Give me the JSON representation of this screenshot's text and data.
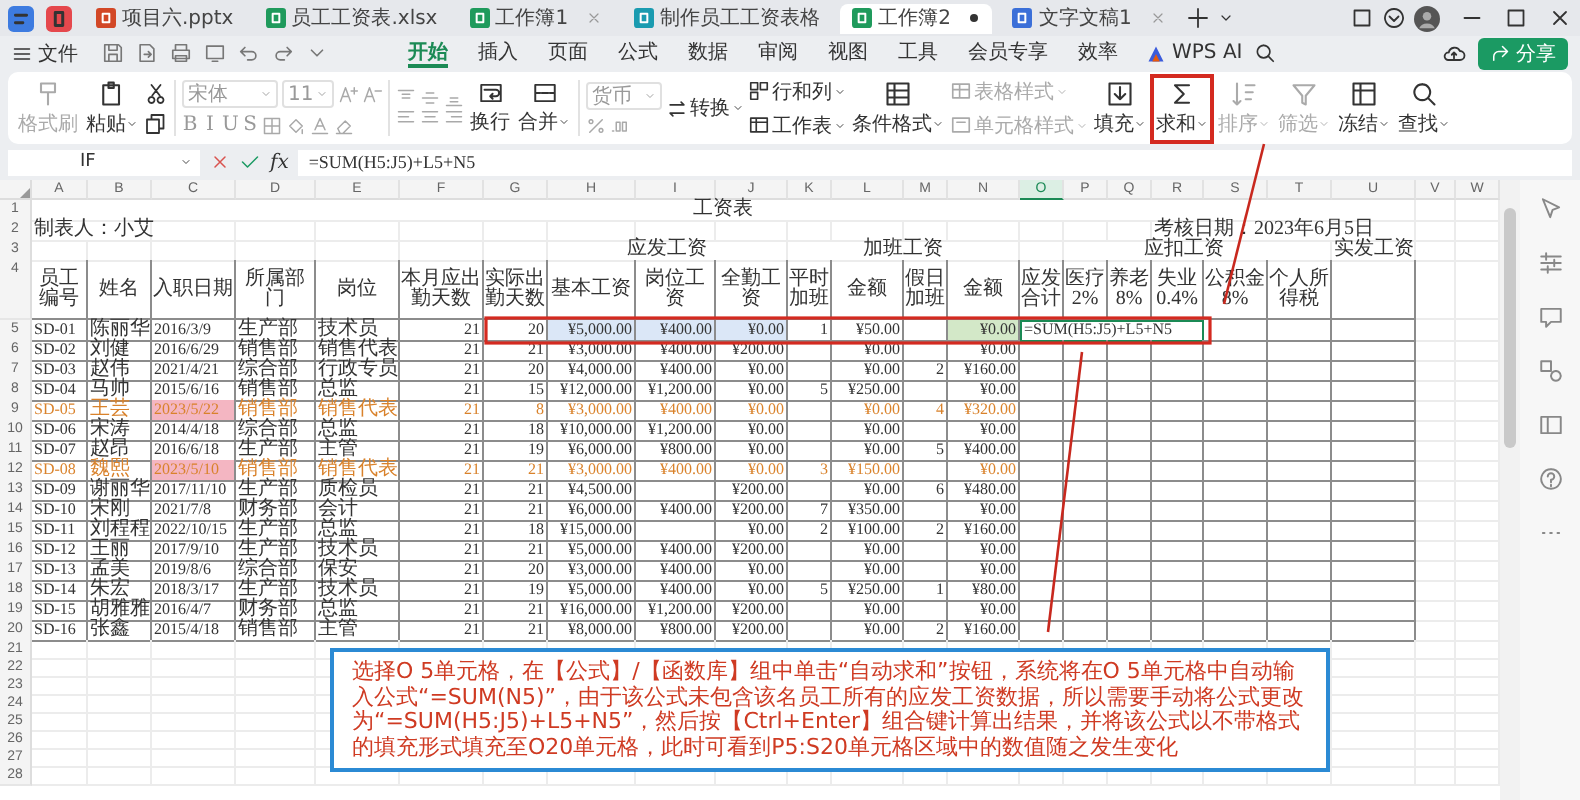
{
  "app_tabs": [
    {
      "label": "项目六.pptx",
      "kind": "presentation",
      "selected": false,
      "close_button": false,
      "unsaved": false
    },
    {
      "label": "员工工资表.xlsx",
      "kind": "spreadsheet",
      "selected": false,
      "close_button": false,
      "unsaved": false
    },
    {
      "label": "工作簿1",
      "kind": "spreadsheet",
      "selected": false,
      "close_button": true,
      "unsaved": false
    },
    {
      "label": "制作员工工资表格",
      "kind": "flowchart",
      "selected": false,
      "close_button": false,
      "unsaved": false
    },
    {
      "label": "工作簿2",
      "kind": "spreadsheet",
      "selected": true,
      "close_button": false,
      "unsaved": true
    },
    {
      "label": "文字文稿1",
      "kind": "document",
      "selected": false,
      "close_button": true,
      "unsaved": false
    }
  ],
  "menu": {
    "file": "文件",
    "tabs": [
      {
        "label": "开始",
        "selected": true
      },
      {
        "label": "插入",
        "selected": false
      },
      {
        "label": "页面",
        "selected": false
      },
      {
        "label": "公式",
        "selected": false
      },
      {
        "label": "数据",
        "selected": false
      },
      {
        "label": "审阅",
        "selected": false
      },
      {
        "label": "视图",
        "selected": false
      },
      {
        "label": "工具",
        "selected": false
      },
      {
        "label": "会员专享",
        "selected": false
      },
      {
        "label": "效率",
        "selected": false
      }
    ],
    "ai": "WPS AI",
    "share": "分享"
  },
  "ribbon": {
    "clipboard": [
      {
        "label": "格式刷",
        "disabled": true
      },
      {
        "label": "粘贴",
        "disabled": false
      }
    ],
    "font": {
      "name": "宋体",
      "size": "11",
      "styles": [
        "B",
        "I",
        "U",
        "S"
      ]
    },
    "wrap": "换行",
    "merge": "合并",
    "number_format": "货币",
    "tool_columns": [
      {
        "kind": "stack",
        "tools": [
          {
            "label": "转换",
            "disabled": false
          }
        ]
      },
      {
        "kind": "stack",
        "tools": [
          {
            "label": "行和列",
            "disabled": false
          },
          {
            "label": "工作表",
            "disabled": false
          }
        ]
      },
      {
        "kind": "large",
        "label": "条件格式",
        "disabled": false,
        "highlighted": false
      },
      {
        "kind": "stack",
        "tools": [
          {
            "label": "表格样式",
            "disabled": true
          },
          {
            "label": "单元格样式",
            "disabled": true
          }
        ]
      },
      {
        "kind": "large",
        "label": "填充",
        "disabled": false,
        "highlighted": false
      },
      {
        "kind": "large",
        "label": "求和",
        "disabled": false,
        "highlighted": true
      },
      {
        "kind": "large",
        "label": "排序",
        "disabled": true,
        "highlighted": false
      },
      {
        "kind": "large",
        "label": "筛选",
        "disabled": true,
        "highlighted": false
      },
      {
        "kind": "large",
        "label": "冻结",
        "disabled": false,
        "highlighted": false
      },
      {
        "kind": "large",
        "label": "查找",
        "disabled": false,
        "highlighted": false
      }
    ]
  },
  "formula_bar": {
    "name_box": "IF",
    "function_label": "fx",
    "formula": "=SUM(H5:J5)+L5+N5"
  },
  "sheet": {
    "columns": [
      {
        "letter": "A",
        "selected": false
      },
      {
        "letter": "B",
        "selected": false
      },
      {
        "letter": "C",
        "selected": false
      },
      {
        "letter": "D",
        "selected": false
      },
      {
        "letter": "E",
        "selected": false
      },
      {
        "letter": "F",
        "selected": false
      },
      {
        "letter": "G",
        "selected": false
      },
      {
        "letter": "H",
        "selected": false
      },
      {
        "letter": "I",
        "selected": false
      },
      {
        "letter": "J",
        "selected": false
      },
      {
        "letter": "K",
        "selected": false
      },
      {
        "letter": "L",
        "selected": false
      },
      {
        "letter": "M",
        "selected": false
      },
      {
        "letter": "N",
        "selected": false
      },
      {
        "letter": "O",
        "selected": true
      },
      {
        "letter": "P",
        "selected": false
      },
      {
        "letter": "Q",
        "selected": false
      },
      {
        "letter": "R",
        "selected": false
      },
      {
        "letter": "S",
        "selected": false
      },
      {
        "letter": "T",
        "selected": false
      },
      {
        "letter": "U",
        "selected": false
      },
      {
        "letter": "V",
        "selected": false
      },
      {
        "letter": "W",
        "selected": false
      }
    ],
    "row_numbers": [
      "1",
      "2",
      "3",
      "4",
      "5",
      "6",
      "7",
      "8",
      "9",
      "10",
      "11",
      "12",
      "13",
      "14",
      "15",
      "16",
      "17",
      "18",
      "19",
      "20",
      "21",
      "22",
      "23",
      "24",
      "25",
      "26",
      "27",
      "28"
    ],
    "title": "工资表",
    "maker": "制表人：小艾",
    "check_date": "考核日期：2023年6月5日",
    "group_headers": {
      "payable": "应发工资",
      "overtime": "加班工资",
      "deductions": "应扣工资",
      "net_pay": "实发工资"
    },
    "headers": [
      "员工编号",
      "姓名",
      "入职日期",
      "所属部门",
      "岗位",
      "本月应出勤天数",
      "实际出勤天数",
      "基本工资",
      "岗位工资",
      "全勤工资",
      "平时加班",
      "金额",
      "假日加班",
      "金额",
      "应发合计",
      "医疗2%",
      "养老8%",
      "失业0.4%",
      "公积金8%",
      "个人所得税"
    ],
    "records": [
      {
        "id": "SD-01",
        "name": "陈丽华",
        "hired": "2016/3/9",
        "dept": "生产部",
        "post": "技术员",
        "due": "21",
        "actual": "20",
        "base": "¥5,000.00",
        "post_pay": "¥400.00",
        "attend": "¥0.00",
        "ot": "1",
        "ot_pay": "¥50.00",
        "hol_pay": "¥0.00",
        "flagged": false,
        "in_formula": true,
        "formula": "=SUM(H5:J5)+L5+N5"
      },
      {
        "id": "SD-02",
        "name": "刘健",
        "hired": "2016/6/29",
        "dept": "销售部",
        "post": "销售代表",
        "due": "21",
        "actual": "21",
        "base": "¥3,000.00",
        "post_pay": "¥400.00",
        "attend": "¥200.00",
        "ot_pay": "¥0.00",
        "hol_pay": "¥0.00",
        "flagged": false,
        "in_formula": false
      },
      {
        "id": "SD-03",
        "name": "赵伟",
        "hired": "2021/4/21",
        "dept": "综合部",
        "post": "行政专员",
        "due": "21",
        "actual": "20",
        "base": "¥4,000.00",
        "post_pay": "¥400.00",
        "attend": "¥0.00",
        "ot_pay": "¥0.00",
        "hol": "2",
        "hol_pay": "¥160.00",
        "flagged": false,
        "in_formula": false
      },
      {
        "id": "SD-04",
        "name": "马帅",
        "hired": "2015/6/16",
        "dept": "销售部",
        "post": "总监",
        "due": "21",
        "actual": "15",
        "base": "¥12,000.00",
        "post_pay": "¥1,200.00",
        "attend": "¥0.00",
        "ot": "5",
        "ot_pay": "¥250.00",
        "hol_pay": "¥0.00",
        "flagged": false,
        "in_formula": false
      },
      {
        "id": "SD-05",
        "name": "王芸",
        "hired": "2023/5/22",
        "dept": "销售部",
        "post": "销售代表",
        "due": "21",
        "actual": "8",
        "base": "¥3,000.00",
        "post_pay": "¥400.00",
        "attend": "¥0.00",
        "ot_pay": "¥0.00",
        "hol": "4",
        "hol_pay": "¥320.00",
        "flagged": true,
        "in_formula": false
      },
      {
        "id": "SD-06",
        "name": "宋涛",
        "hired": "2014/4/18",
        "dept": "综合部",
        "post": "总监",
        "due": "21",
        "actual": "18",
        "base": "¥10,000.00",
        "post_pay": "¥1,200.00",
        "attend": "¥0.00",
        "ot_pay": "¥0.00",
        "hol_pay": "¥0.00",
        "flagged": false,
        "in_formula": false
      },
      {
        "id": "SD-07",
        "name": "赵昂",
        "hired": "2016/6/18",
        "dept": "生产部",
        "post": "主管",
        "due": "21",
        "actual": "19",
        "base": "¥6,000.00",
        "post_pay": "¥800.00",
        "attend": "¥0.00",
        "ot_pay": "¥0.00",
        "hol": "5",
        "hol_pay": "¥400.00",
        "flagged": false,
        "in_formula": false
      },
      {
        "id": "SD-08",
        "name": "魏熙",
        "hired": "2023/5/10",
        "dept": "销售部",
        "post": "销售代表",
        "due": "21",
        "actual": "21",
        "base": "¥3,000.00",
        "post_pay": "¥400.00",
        "attend": "¥0.00",
        "ot": "3",
        "ot_pay": "¥150.00",
        "hol_pay": "¥0.00",
        "flagged": true,
        "in_formula": false
      },
      {
        "id": "SD-09",
        "name": "谢丽华",
        "hired": "2017/11/10",
        "dept": "生产部",
        "post": "质检员",
        "due": "21",
        "actual": "21",
        "base": "¥4,500.00",
        "attend": "¥200.00",
        "ot_pay": "¥0.00",
        "hol": "6",
        "hol_pay": "¥480.00",
        "flagged": false,
        "in_formula": false
      },
      {
        "id": "SD-10",
        "name": "宋刚",
        "hired": "2021/7/8",
        "dept": "财务部",
        "post": "会计",
        "due": "21",
        "actual": "21",
        "base": "¥6,000.00",
        "post_pay": "¥400.00",
        "attend": "¥200.00",
        "ot": "7",
        "ot_pay": "¥350.00",
        "hol_pay": "¥0.00",
        "flagged": false,
        "in_formula": false
      },
      {
        "id": "SD-11",
        "name": "刘程程",
        "hired": "2022/10/15",
        "dept": "生产部",
        "post": "总监",
        "due": "21",
        "actual": "18",
        "base": "¥15,000.00",
        "attend": "¥0.00",
        "ot": "2",
        "ot_pay": "¥100.00",
        "hol": "2",
        "hol_pay": "¥160.00",
        "flagged": false,
        "in_formula": false
      },
      {
        "id": "SD-12",
        "name": "王丽",
        "hired": "2017/9/10",
        "dept": "生产部",
        "post": "技术员",
        "due": "21",
        "actual": "21",
        "base": "¥5,000.00",
        "post_pay": "¥400.00",
        "attend": "¥200.00",
        "ot_pay": "¥0.00",
        "hol_pay": "¥0.00",
        "flagged": false,
        "in_formula": false
      },
      {
        "id": "SD-13",
        "name": "孟美",
        "hired": "2019/8/6",
        "dept": "综合部",
        "post": "保安",
        "due": "21",
        "actual": "20",
        "base": "¥3,000.00",
        "post_pay": "¥400.00",
        "attend": "¥0.00",
        "ot_pay": "¥0.00",
        "hol_pay": "¥0.00",
        "flagged": false,
        "in_formula": false
      },
      {
        "id": "SD-14",
        "name": "朱宏",
        "hired": "2018/3/17",
        "dept": "生产部",
        "post": "技术员",
        "due": "21",
        "actual": "19",
        "base": "¥5,000.00",
        "post_pay": "¥400.00",
        "attend": "¥0.00",
        "ot": "5",
        "ot_pay": "¥250.00",
        "hol": "1",
        "hol_pay": "¥80.00",
        "flagged": false,
        "in_formula": false
      },
      {
        "id": "SD-15",
        "name": "胡雅雅",
        "hired": "2016/4/7",
        "dept": "财务部",
        "post": "总监",
        "due": "21",
        "actual": "21",
        "base": "¥16,000.00",
        "post_pay": "¥1,200.00",
        "attend": "¥200.00",
        "ot_pay": "¥0.00",
        "hol_pay": "¥0.00",
        "flagged": false,
        "in_formula": false
      },
      {
        "id": "SD-16",
        "name": "张鑫",
        "hired": "2015/4/18",
        "dept": "销售部",
        "post": "主管",
        "due": "21",
        "actual": "21",
        "base": "¥8,000.00",
        "post_pay": "¥800.00",
        "attend": "¥200.00",
        "ot_pay": "¥0.00",
        "hol": "2",
        "hol_pay": "¥160.00",
        "flagged": false,
        "in_formula": false
      }
    ]
  },
  "callout": {
    "text": "选择O 5单元格，在【公式】/【函数库】组中单击“自动求和”按钮，系统将在O 5单元格中自动输入公式“=SUM(N5)”，由于该公式未包含该名员工所有的应发工资数据，所以需要手动将公式更改为“=SUM(H5:J5)+L5+N5”，然后按【Ctrl+Enter】组合键计算出结果，并将该公式以不带格式的填充形式填充至O20单元格，此时可看到P5:S20单元格区域中的数值随之发生变化"
  }
}
